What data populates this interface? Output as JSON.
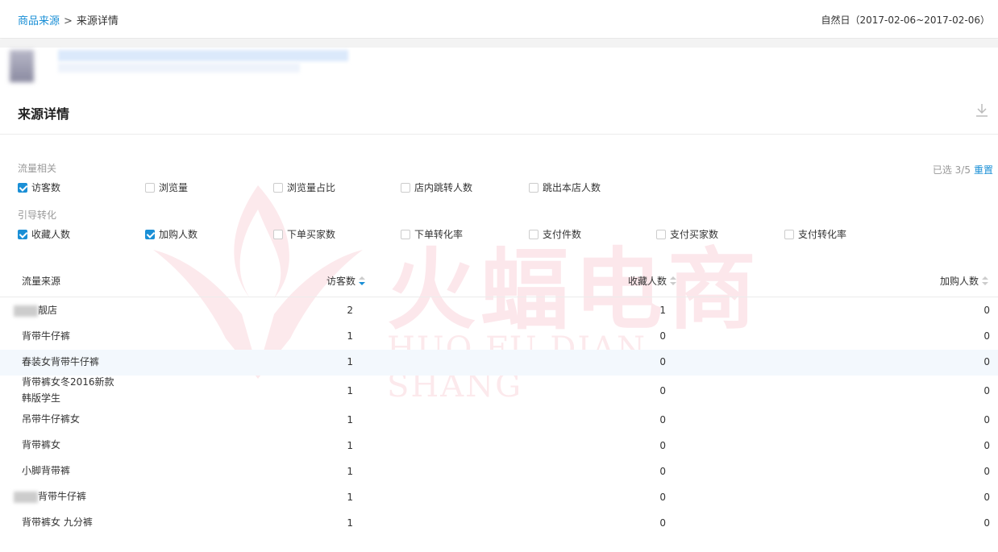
{
  "breadcrumb": {
    "parent": "商品来源",
    "separator": ">",
    "current": "来源详情"
  },
  "date_range": "自然日（2017-02-06~2017-02-06）",
  "section_title": "来源详情",
  "filters": {
    "selected_text": "已选 3/5",
    "reset_label": "重置",
    "traffic_label": "流量相关",
    "traffic_options": [
      {
        "label": "访客数",
        "checked": true
      },
      {
        "label": "浏览量",
        "checked": false
      },
      {
        "label": "浏览量占比",
        "checked": false
      },
      {
        "label": "店内跳转人数",
        "checked": false
      },
      {
        "label": "跳出本店人数",
        "checked": false
      }
    ],
    "conversion_label": "引导转化",
    "conversion_options": [
      {
        "label": "收藏人数",
        "checked": true
      },
      {
        "label": "加购人数",
        "checked": true
      },
      {
        "label": "下单买家数",
        "checked": false
      },
      {
        "label": "下单转化率",
        "checked": false
      },
      {
        "label": "支付件数",
        "checked": false
      },
      {
        "label": "支付买家数",
        "checked": false
      },
      {
        "label": "支付转化率",
        "checked": false
      }
    ]
  },
  "table": {
    "headers": [
      "流量来源",
      "访客数",
      "收藏人数",
      "加购人数"
    ],
    "rows": [
      {
        "source": "靓店",
        "redacted": true,
        "visitors": "2",
        "favorites": "1",
        "carts": "0"
      },
      {
        "source": "背带牛仔裤",
        "visitors": "1",
        "favorites": "0",
        "carts": "0"
      },
      {
        "source": "春装女背带牛仔裤",
        "visitors": "1",
        "favorites": "0",
        "carts": "0"
      },
      {
        "source": "背带裤女冬2016新款",
        "source2": "韩版学生",
        "visitors": "1",
        "favorites": "0",
        "carts": "0"
      },
      {
        "source": "吊带牛仔裤女",
        "visitors": "1",
        "favorites": "0",
        "carts": "0"
      },
      {
        "source": "背带裤女",
        "visitors": "1",
        "favorites": "0",
        "carts": "0"
      },
      {
        "source": "小脚背带裤",
        "visitors": "1",
        "favorites": "0",
        "carts": "0"
      },
      {
        "source": "背带牛仔裤",
        "redacted": true,
        "visitors": "1",
        "favorites": "0",
        "carts": "0"
      },
      {
        "source": "背带裤女 九分裤",
        "visitors": "1",
        "favorites": "0",
        "carts": "0"
      }
    ]
  },
  "watermark": {
    "text": "火蝠电商",
    "sub": "HUO FU DIAN SHANG"
  },
  "colors": {
    "accent": "#1a8fd6",
    "watermark": "#e64664"
  }
}
